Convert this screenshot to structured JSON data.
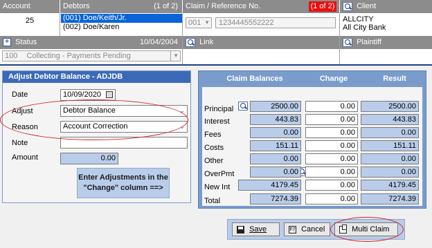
{
  "header": {
    "account_label": "Account",
    "account_value": "25",
    "debtors_label": "Debtors",
    "debtors_count": "(1 of 2)",
    "debtors": [
      "(001) Doe/Keith/Jr.",
      "(002) Doe/Karen"
    ],
    "claim_label": "Claim / Reference No.",
    "claim_count": "(1 of 2)",
    "claim_select": "001",
    "claim_reference": "1234445552222",
    "client_label": "Client",
    "client_code": "ALLCITY",
    "client_name": "All City Bank",
    "status_label": "Status",
    "status_date": "10/04/2004",
    "status_value": "100",
    "status_text": "Collecting - Payments Pending",
    "link_label": "Link",
    "plaintiff_label": "Plaintiff"
  },
  "form": {
    "title": "Adjust Debtor Balance - ADJDB",
    "date_label": "Date",
    "date_value": "10/09/2020",
    "adjust_label": "Adjust",
    "adjust_value": "Debtor Balance",
    "reason_label": "Reason",
    "reason_value": "Account Correction",
    "note_label": "Note",
    "note_value": "",
    "amount_label": "Amount",
    "amount_value": "0.00",
    "hint_line1": "Enter Adjustments in the",
    "hint_line2": "\"Change\" column ==>"
  },
  "balances": {
    "col_claim": "Claim Balances",
    "col_change": "Change",
    "col_result": "Result",
    "rows": [
      {
        "label": "Principal",
        "claim": "2500.00",
        "change": "0.00",
        "result": "2500.00"
      },
      {
        "label": "Interest",
        "claim": "443.83",
        "change": "0.00",
        "result": "443.83"
      },
      {
        "label": "Fees",
        "claim": "0.00",
        "change": "0.00",
        "result": "0.00"
      },
      {
        "label": "Costs",
        "claim": "151.11",
        "change": "0.00",
        "result": "151.11"
      },
      {
        "label": "Other",
        "claim": "0.00",
        "change": "0.00",
        "result": "0.00"
      },
      {
        "label": "OverPmt",
        "claim": "0.00",
        "change": "0.00",
        "result": "0.00"
      },
      {
        "label": "New Int",
        "claim": "4179.45",
        "change": "0.00",
        "result": "4179.45"
      },
      {
        "label": "Total",
        "claim": "7274.39",
        "change": "0.00",
        "result": "7274.39"
      }
    ]
  },
  "buttons": {
    "save": "Save",
    "cancel": "Cancel",
    "multi_claim": "Multi Claim"
  },
  "colors": {
    "header_gray": "#8c8c8c",
    "panel_blue": "#7a9ccc",
    "input_blue": "#b9cdea",
    "count_red": "#e81010",
    "highlight_red": "#d42020",
    "selection_blue": "#0a64d8"
  }
}
